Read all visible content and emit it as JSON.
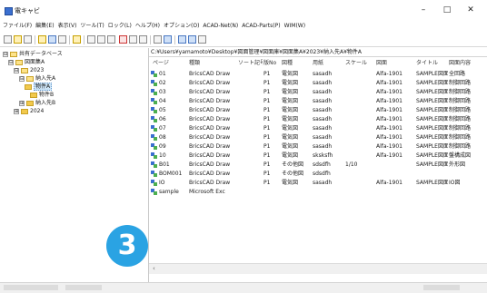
{
  "window": {
    "title": "電キャビ",
    "controls": {
      "minimize": "–",
      "maximize": "□",
      "close": "✕"
    }
  },
  "menu": [
    "ファイル(F)",
    "編集(E)",
    "表示(V)",
    "ツール(T)",
    "ロック(L)",
    "ヘルプ(H)",
    "オプション(O)",
    "ACAD-Net(N)",
    "ACAD-Parts(P)",
    "WIM(W)"
  ],
  "tree": {
    "items": [
      {
        "label": "共有データベース",
        "toggle": "⊟",
        "icon": "database-icon"
      },
      {
        "label": "図面集A",
        "toggle": "⊟",
        "icon": "database-icon"
      },
      {
        "label": "2023",
        "toggle": "⊟",
        "icon": "folder-icon"
      },
      {
        "label": "納入先A",
        "toggle": "⊟",
        "icon": "folder-icon"
      },
      {
        "label": "物件A",
        "toggle": "",
        "icon": "drawing-folder-icon",
        "selected": true
      },
      {
        "label": "物件B",
        "toggle": "",
        "icon": "folder-icon"
      },
      {
        "label": "納入先B",
        "toggle": "⊞",
        "icon": "folder-icon"
      },
      {
        "label": "2024",
        "toggle": "⊞",
        "icon": "folder-icon"
      }
    ]
  },
  "path": "C:¥Users¥yamamoto¥Desktop¥図面管理¥図面庫¥図面集A¥2023¥納入先A¥物件A",
  "columns": [
    "ページ",
    "種類",
    "ソート記号",
    "版No",
    "図種",
    "用紙",
    "スケール",
    "図面",
    "タイトル",
    "図面内容"
  ],
  "rows": [
    [
      "01",
      "BricsCAD Draw",
      "",
      "P1",
      "電気図",
      "sasadh",
      "",
      "Alfa-1901",
      "SAMPLE図面",
      "全回路"
    ],
    [
      "02",
      "BricsCAD Draw",
      "",
      "P1",
      "電気図",
      "sasadh",
      "",
      "Alfa-1901",
      "SAMPLE図面",
      "制御回路"
    ],
    [
      "03",
      "BricsCAD Draw",
      "",
      "P1",
      "電気図",
      "sasadh",
      "",
      "Alfa-1901",
      "SAMPLE図面",
      "制御回路"
    ],
    [
      "04",
      "BricsCAD Draw",
      "",
      "P1",
      "電気図",
      "sasadh",
      "",
      "Alfa-1901",
      "SAMPLE図面",
      "制御回路"
    ],
    [
      "05",
      "BricsCAD Draw",
      "",
      "P1",
      "電気図",
      "sasadh",
      "",
      "Alfa-1901",
      "SAMPLE図面",
      "制御回路"
    ],
    [
      "06",
      "BricsCAD Draw",
      "",
      "P1",
      "電気図",
      "sasadh",
      "",
      "Alfa-1901",
      "SAMPLE図面",
      "制御回路"
    ],
    [
      "07",
      "BricsCAD Draw",
      "",
      "P1",
      "電気図",
      "sasadh",
      "",
      "Alfa-1901",
      "SAMPLE図面",
      "制御回路"
    ],
    [
      "08",
      "BricsCAD Draw",
      "",
      "P1",
      "電気図",
      "sasadh",
      "",
      "Alfa-1901",
      "SAMPLE図面",
      "制御回路"
    ],
    [
      "09",
      "BricsCAD Draw",
      "",
      "P1",
      "電気図",
      "sasadh",
      "",
      "Alfa-1901",
      "SAMPLE図面",
      "制御回路"
    ],
    [
      "10",
      "BricsCAD Draw",
      "",
      "P1",
      "電気図",
      "sksksfh",
      "",
      "Alfa-1901",
      "SAMPLE図面",
      "盤構成図"
    ],
    [
      "B01",
      "BricsCAD Draw",
      "",
      "P1",
      "その他図",
      "sdsdfh",
      "1/10",
      "",
      "SAMPLE図面",
      "外形図"
    ],
    [
      "BOM001",
      "BricsCAD Draw",
      "",
      "P1",
      "その他図",
      "sdsdfh",
      "",
      "",
      "",
      ""
    ],
    [
      "IO",
      "BricsCAD Draw",
      "",
      "P1",
      "電気図",
      "sasadh",
      "",
      "Alfa-1901",
      "SAMPLE図面",
      "IO図"
    ],
    [
      "sample",
      "Microsoft Exc",
      "",
      "",
      "",
      "",
      "",
      "",
      "",
      ""
    ]
  ],
  "step_badge": "3",
  "colors": {
    "badge": "#2aa3e3",
    "selection": "#cce4f7"
  }
}
